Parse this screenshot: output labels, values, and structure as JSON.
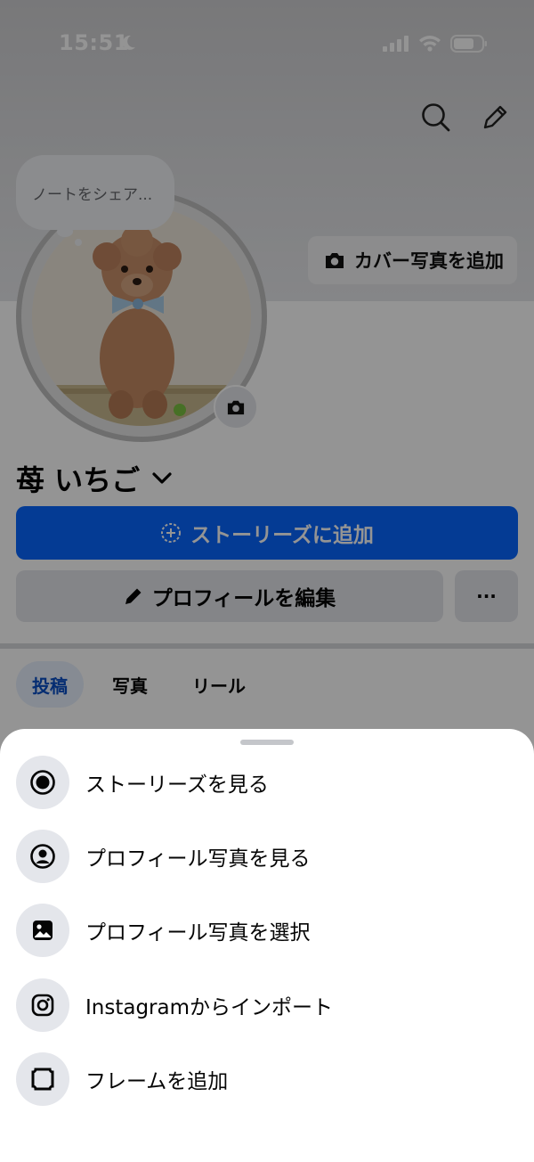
{
  "status_bar": {
    "time": "15:51"
  },
  "header": {
    "add_cover_label": "カバー写真を追加"
  },
  "profile": {
    "note_placeholder": "ノートをシェア...",
    "name": "苺 いちご",
    "add_story_label": "ストーリーズに追加",
    "edit_profile_label": "プロフィールを編集",
    "more_label": "···"
  },
  "tabs": [
    {
      "label": "投稿",
      "active": true
    },
    {
      "label": "写真",
      "active": false
    },
    {
      "label": "リール",
      "active": false
    }
  ],
  "sheet": {
    "items": [
      {
        "label": "ストーリーズを見る",
        "icon": "record-icon"
      },
      {
        "label": "プロフィール写真を見る",
        "icon": "user-circle-icon"
      },
      {
        "label": "プロフィール写真を選択",
        "icon": "image-icon"
      },
      {
        "label": "Instagramからインポート",
        "icon": "instagram-icon"
      },
      {
        "label": "フレームを追加",
        "icon": "frame-icon"
      }
    ]
  },
  "colors": {
    "primary": "#0866ff",
    "tab_active_bg": "#e7f0fe",
    "tab_active_text": "#0a4fc4"
  }
}
